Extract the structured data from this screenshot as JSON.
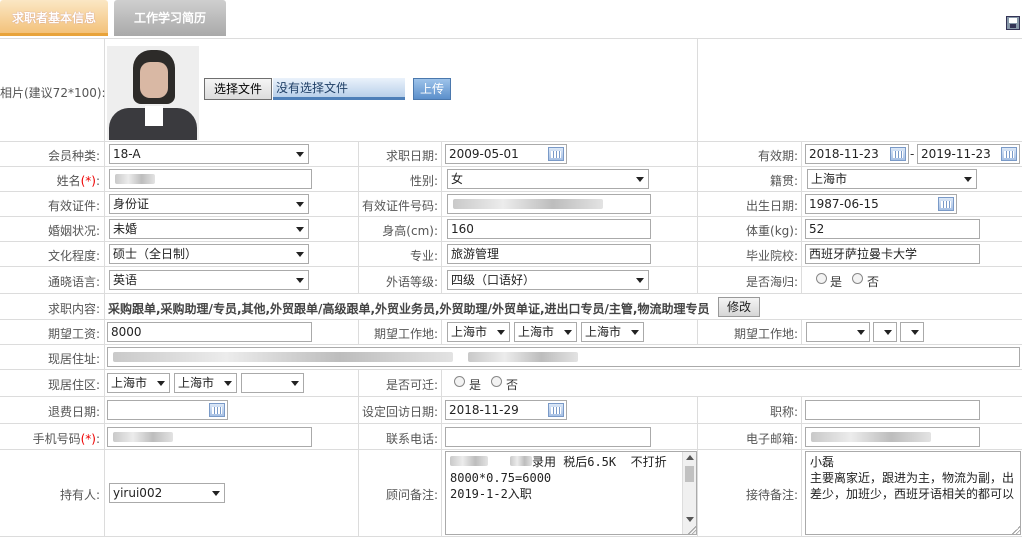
{
  "tabs": [
    {
      "label": "求职者基本信息",
      "active": true
    },
    {
      "label": "工作学习简历",
      "active": false
    }
  ],
  "photo": {
    "label": "相片(建议72*100):",
    "choose_button": "选择文件",
    "file_status": "没有选择文件",
    "upload_button": "上传"
  },
  "fields": {
    "member_type": {
      "label": "会员种类:",
      "value": "18-A"
    },
    "apply_date": {
      "label": "求职日期:",
      "value": "2009-05-01"
    },
    "valid_period": {
      "label": "有效期:",
      "from": "2018-11-23",
      "sep": "-",
      "to": "2019-11-23"
    },
    "name": {
      "label": "姓名",
      "req": "(*)",
      "colon": ":"
    },
    "gender": {
      "label": "性别:",
      "value": "女"
    },
    "native_place": {
      "label": "籍贯:",
      "value": "上海市"
    },
    "id_type": {
      "label": "有效证件:",
      "value": "身份证"
    },
    "id_number": {
      "label": "有效证件号码:"
    },
    "birth_date": {
      "label": "出生日期:",
      "value": "1987-06-15"
    },
    "marital": {
      "label": "婚姻状况:",
      "value": "未婚"
    },
    "height": {
      "label": "身高(cm):",
      "value": "160"
    },
    "weight": {
      "label": "体重(kg):",
      "value": "52"
    },
    "education": {
      "label": "文化程度:",
      "value": "硕士（全日制）"
    },
    "major": {
      "label": "专业:",
      "value": "旅游管理"
    },
    "school": {
      "label": "毕业院校:",
      "value": "西班牙萨拉曼卡大学"
    },
    "language": {
      "label": "通晓语言:",
      "value": "英语"
    },
    "lang_level": {
      "label": "外语等级:",
      "value": "四级（口语好）"
    },
    "returnee": {
      "label": "是否海归:",
      "yes": "是",
      "no": "否"
    },
    "job_content": {
      "label": "求职内容:",
      "value": "采购跟单,采购助理/专员,其他,外贸跟单/高级跟单,外贸业务员,外贸助理/外贸单证,进出口专员/主管,物流助理专员",
      "edit_button": "修改"
    },
    "salary": {
      "label": "期望工资:",
      "value": "8000"
    },
    "work_place": {
      "label": "期望工作地:",
      "v1": "上海市",
      "v2": "上海市",
      "v3": "上海市"
    },
    "work_place2": {
      "label": "期望工作地:"
    },
    "address": {
      "label": "现居住址:"
    },
    "district": {
      "label": "现居住区:",
      "v1": "上海市",
      "v2": "上海市"
    },
    "relocate": {
      "label": "是否可迁:",
      "yes": "是",
      "no": "否"
    },
    "refund_date": {
      "label": "退费日期:"
    },
    "visit_date": {
      "label": "设定回访日期:",
      "value": "2018-11-29"
    },
    "title": {
      "label": "职称:"
    },
    "mobile": {
      "label": "手机号码",
      "req": "(*)",
      "colon": ":"
    },
    "phone": {
      "label": "联系电话:"
    },
    "email": {
      "label": "电子邮箱:"
    },
    "owner": {
      "label": "持有人:",
      "value": "yirui002"
    },
    "consultant_note": {
      "label": "顾问备注:",
      "value": "录用 税后6.5K  不打折\n8000*0.75=6000\n2019-1-2入职"
    },
    "reception_note": {
      "label": "接待备注:",
      "value": "小磊\n主要离家近，跟进为主，物流为副，出差少，加班少，西班牙语相关的都可以"
    }
  }
}
